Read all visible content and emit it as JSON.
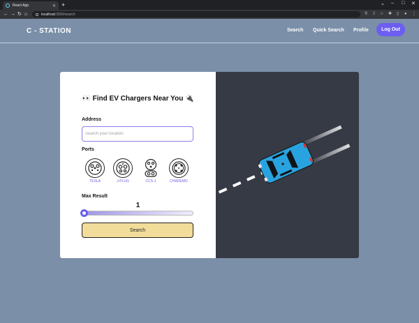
{
  "browser": {
    "tab_title": "React App",
    "url_host": "localhost:",
    "url_path": "3000/search",
    "new_tab": "+"
  },
  "header": {
    "logo": "C - STATION",
    "nav": [
      "Search",
      "Quick Search",
      "Profile"
    ],
    "logout": "Log Out"
  },
  "form": {
    "heading": "👀 Find EV Chargers Near You 🔌",
    "address_label": "Address",
    "address_placeholder": "Search your location",
    "address_value": "",
    "ports_label": "Ports",
    "ports": [
      "TESLA",
      "J-PLUG",
      "CCS-1",
      "CHADEMO"
    ],
    "max_result_label": "Max Result",
    "max_result_value": "1",
    "max_result_fraction": 0.0,
    "submit": "Search"
  },
  "colors": {
    "background": "#7b8fa8",
    "accent": "#6b5ef0",
    "button": "#f2dc9a",
    "panel_dark": "#363a44",
    "car": "#29a3df"
  }
}
